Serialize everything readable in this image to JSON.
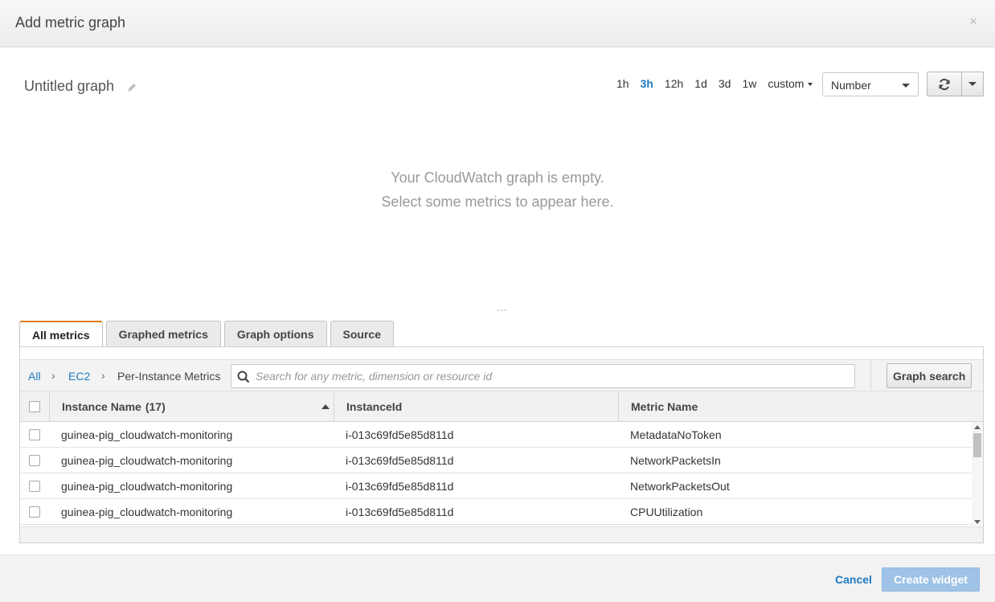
{
  "modal": {
    "title": "Add metric graph",
    "close": "×"
  },
  "graph": {
    "title": "Untitled graph",
    "empty_line1": "Your CloudWatch graph is empty.",
    "empty_line2": "Select some metrics to appear here."
  },
  "time_ranges": {
    "items": [
      "1h",
      "3h",
      "12h",
      "1d",
      "3d",
      "1w"
    ],
    "active": "3h",
    "custom": "custom"
  },
  "view_select": {
    "value": "Number"
  },
  "resize_handle": "---",
  "tabs": [
    "All metrics",
    "Graphed metrics",
    "Graph options",
    "Source"
  ],
  "breadcrumb": {
    "all": "All",
    "ec2": "EC2",
    "current": "Per-Instance Metrics",
    "sep": "›"
  },
  "search": {
    "placeholder": "Search for any metric, dimension or resource id",
    "button": "Graph search"
  },
  "table": {
    "headers": {
      "instance_name": "Instance Name",
      "count": "(17)",
      "instance_id": "InstanceId",
      "metric_name": "Metric Name"
    },
    "rows": [
      {
        "instance_name": "guinea-pig_cloudwatch-monitoring",
        "instance_id": "i-013c69fd5e85d811d",
        "metric_name": "MetadataNoToken"
      },
      {
        "instance_name": "guinea-pig_cloudwatch-monitoring",
        "instance_id": "i-013c69fd5e85d811d",
        "metric_name": "NetworkPacketsIn"
      },
      {
        "instance_name": "guinea-pig_cloudwatch-monitoring",
        "instance_id": "i-013c69fd5e85d811d",
        "metric_name": "NetworkPacketsOut"
      },
      {
        "instance_name": "guinea-pig_cloudwatch-monitoring",
        "instance_id": "i-013c69fd5e85d811d",
        "metric_name": "CPUUtilization"
      }
    ]
  },
  "footer": {
    "cancel": "Cancel",
    "create": "Create widget"
  },
  "colors": {
    "link": "#1d7bc1",
    "tab_accent": "#e07b1a",
    "primary_disabled": "#9fc3e6"
  },
  "icons": [
    "close-icon",
    "pencil-icon",
    "refresh-icon",
    "caret-down-icon",
    "search-icon",
    "sort-asc-icon"
  ]
}
